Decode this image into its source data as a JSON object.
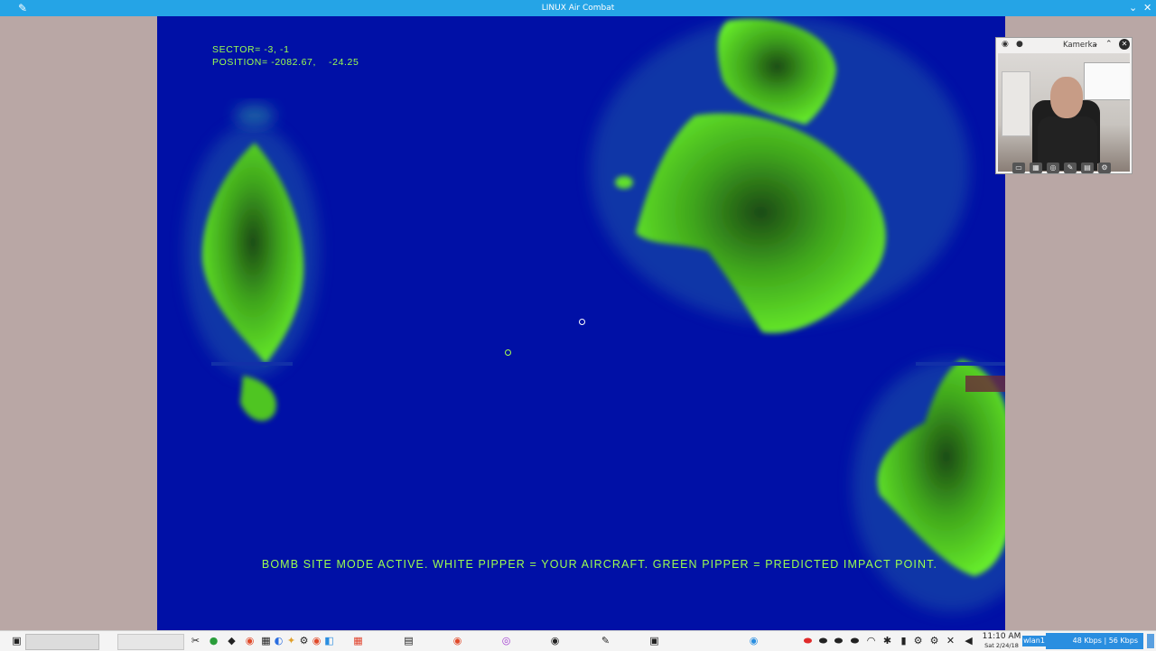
{
  "window": {
    "title": "LINUX Air Combat"
  },
  "hud": {
    "sector": "SECTOR= -3, -1",
    "position": "POSITION= -2082.67,    -24.25",
    "message": "BOMB SITE MODE ACTIVE. WHITE PIPPER = YOUR AIRCRAFT. GREEN PIPPER = PREDICTED IMPACT POINT."
  },
  "colors": {
    "ocean": "#0010a6",
    "terrain": "#5ee02a",
    "hud_text": "#9cff4f",
    "titlebar": "#25a4e6"
  },
  "webcam": {
    "title": "Kamerka"
  },
  "taskbar": {
    "time": "11:10 AM",
    "date": "Sat 2/24/18",
    "network_label": "wlan1",
    "network_speed": "48 Kbps | 56 Kbps"
  }
}
